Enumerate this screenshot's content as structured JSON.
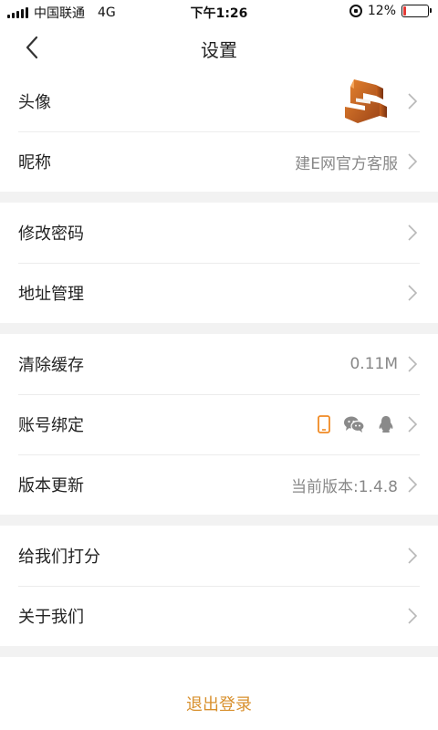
{
  "status_bar": {
    "carrier": "中国联通",
    "network": "4G",
    "time": "下午1:26",
    "battery_percent": "12%",
    "battery_level": 0.12,
    "battery_color": "#e53935"
  },
  "navbar": {
    "title": "设置",
    "back_icon": "chevron-left-icon"
  },
  "sections": {
    "profile": {
      "avatar_label": "头像",
      "nickname_label": "昵称",
      "nickname_value": "建E网官方客服"
    },
    "account": {
      "change_password_label": "修改密码",
      "address_label": "地址管理"
    },
    "system": {
      "clear_cache_label": "清除缓存",
      "cache_size": "0.11M",
      "bind_label": "账号绑定",
      "bind_icons": [
        "phone-icon",
        "wechat-icon",
        "qq-icon"
      ],
      "version_label": "版本更新",
      "version_value": "当前版本:1.4.8"
    },
    "about": {
      "rate_label": "给我们打分",
      "about_label": "关于我们"
    }
  },
  "logout": {
    "label": "退出登录",
    "color": "#d8902d"
  },
  "colors": {
    "accent": "#d8902d",
    "phone_bound": "#f08a24",
    "icon_gray": "#888888"
  }
}
